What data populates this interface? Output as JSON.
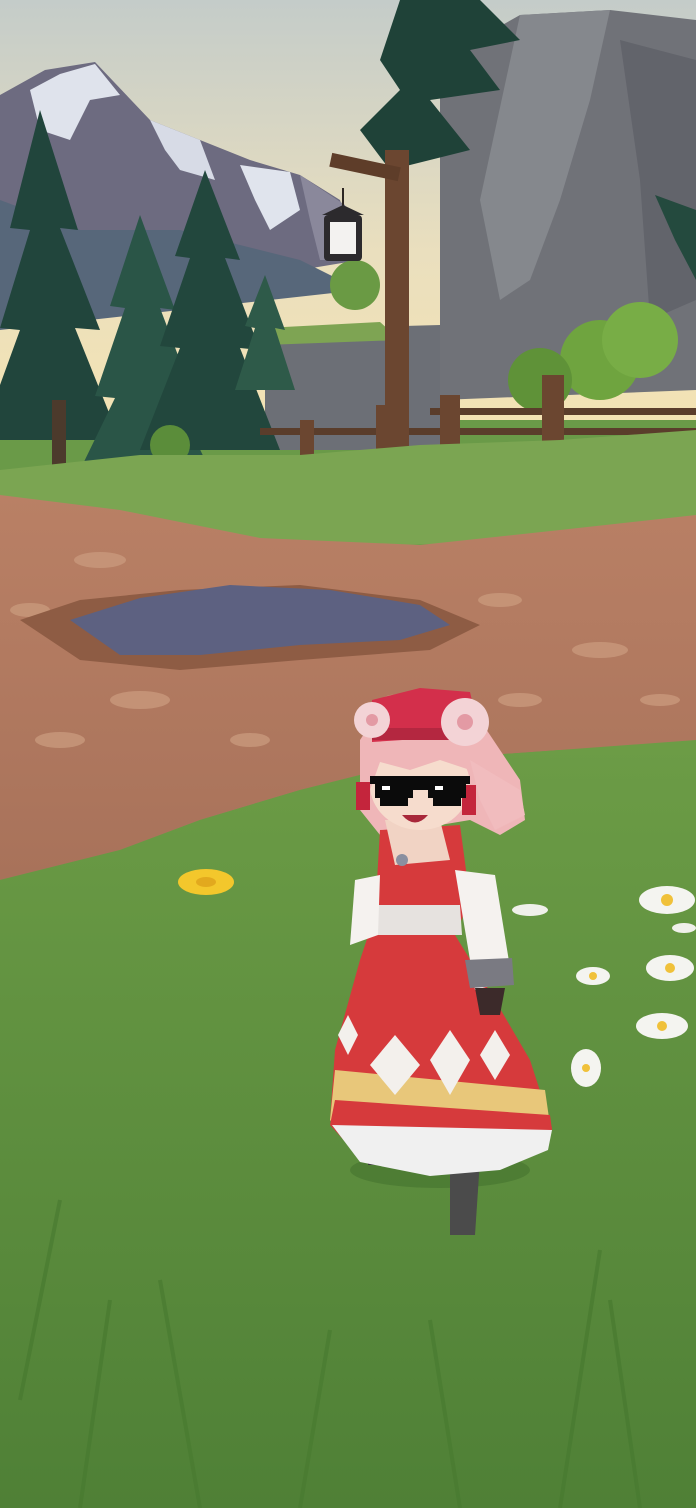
{
  "scene": {
    "description_items": [],
    "colors": {
      "sky_top": "#c9d3c8",
      "sky_bottom": "#f1e2b8",
      "mountain": "#6f6d84",
      "snow": "#e6e9f1",
      "tree_dark": "#22473f",
      "tree_mid": "#2f5c4c",
      "cliff": "#6f727a",
      "cliff_light": "#8b8e93",
      "grass_far": "#7aa352",
      "grass_near": "#5d8e3f",
      "dirt": "#b07a5e",
      "dirt_light": "#c49276",
      "puddle": "#5d6181",
      "post": "#6b4630",
      "dress_red": "#d63a3c",
      "hair_pink": "#efb6b8"
    },
    "character": {
      "accessory": "pixel-sunglasses-icon"
    },
    "flowers": [
      "daisy-icon",
      "dandelion-icon"
    ]
  }
}
